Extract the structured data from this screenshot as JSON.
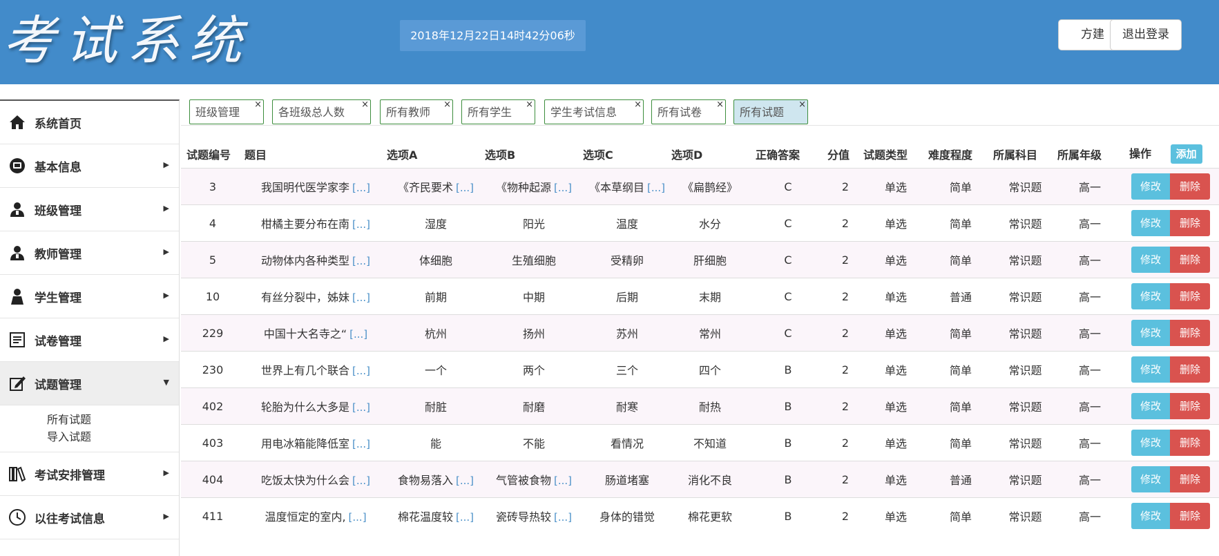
{
  "header": {
    "logo": "考试系统",
    "datetime": "2018年12月22日14时42分06秒",
    "user_label": "方建",
    "logout_label": "退出登录"
  },
  "sidebar": {
    "items": [
      {
        "label": "系统首页",
        "icon": "home-icon",
        "arrow": ""
      },
      {
        "label": "基本信息",
        "icon": "info-icon",
        "arrow": "▶"
      },
      {
        "label": "班级管理",
        "icon": "user-icon",
        "arrow": "▶"
      },
      {
        "label": "教师管理",
        "icon": "user-icon",
        "arrow": "▶"
      },
      {
        "label": "学生管理",
        "icon": "student-icon",
        "arrow": "▶"
      },
      {
        "label": "试卷管理",
        "icon": "document-icon",
        "arrow": "▶"
      },
      {
        "label": "试题管理",
        "icon": "edit-icon",
        "arrow": "▼"
      },
      {
        "label": "考试安排管理",
        "icon": "books-icon",
        "arrow": "▶"
      },
      {
        "label": "以往考试信息",
        "icon": "clock-icon",
        "arrow": "▶"
      }
    ],
    "submenu": [
      "所有试题",
      "导入试题"
    ]
  },
  "tabs": [
    {
      "label": "班级管理",
      "close": "×"
    },
    {
      "label": "各班级总人数",
      "close": "×"
    },
    {
      "label": "所有教师",
      "close": "×"
    },
    {
      "label": "所有学生",
      "close": "×"
    },
    {
      "label": "学生考试信息",
      "close": "×"
    },
    {
      "label": "所有试卷",
      "close": "×"
    },
    {
      "label": "所有试题",
      "close": "×"
    }
  ],
  "table": {
    "columns": [
      "试题编号",
      "题目",
      "选项A",
      "选项B",
      "选项C",
      "选项D",
      "正确答案",
      "分值",
      "试题类型",
      "难度程度",
      "所属科目",
      "所属年级",
      "操作"
    ],
    "add_label": "添加",
    "edit_label": "修改",
    "delete_label": "删除",
    "more": "[...]",
    "rows": [
      {
        "id": "3",
        "title": "我国明代医学家李",
        "a": "《齐民要术",
        "a_more": true,
        "b": "《物种起源",
        "b_more": true,
        "c": "《本草纲目",
        "c_more": true,
        "d": "《扁鹊经》",
        "answer": "C",
        "score": "2",
        "type": "单选",
        "difficulty": "简单",
        "subject": "常识题",
        "grade": "高一"
      },
      {
        "id": "4",
        "title": "柑橘主要分布在南",
        "a": "湿度",
        "a_more": false,
        "b": "阳光",
        "b_more": false,
        "c": "温度",
        "c_more": false,
        "d": "水分",
        "answer": "C",
        "score": "2",
        "type": "单选",
        "difficulty": "简单",
        "subject": "常识题",
        "grade": "高一"
      },
      {
        "id": "5",
        "title": "动物体内各种类型",
        "a": "体细胞",
        "a_more": false,
        "b": "生殖细胞",
        "b_more": false,
        "c": "受精卵",
        "c_more": false,
        "d": "肝细胞",
        "answer": "C",
        "score": "2",
        "type": "单选",
        "difficulty": "简单",
        "subject": "常识题",
        "grade": "高一"
      },
      {
        "id": "10",
        "title": "有丝分裂中，姊妹",
        "a": "前期",
        "a_more": false,
        "b": "中期",
        "b_more": false,
        "c": "后期",
        "c_more": false,
        "d": "末期",
        "answer": "C",
        "score": "2",
        "type": "单选",
        "difficulty": "普通",
        "subject": "常识题",
        "grade": "高一"
      },
      {
        "id": "229",
        "title": "中国十大名寺之“",
        "a": "杭州",
        "a_more": false,
        "b": "扬州",
        "b_more": false,
        "c": "苏州",
        "c_more": false,
        "d": "常州",
        "answer": "C",
        "score": "2",
        "type": "单选",
        "difficulty": "简单",
        "subject": "常识题",
        "grade": "高一"
      },
      {
        "id": "230",
        "title": "世界上有几个联合",
        "a": "一个",
        "a_more": false,
        "b": "两个",
        "b_more": false,
        "c": "三个",
        "c_more": false,
        "d": "四个",
        "answer": "B",
        "score": "2",
        "type": "单选",
        "difficulty": "简单",
        "subject": "常识题",
        "grade": "高一"
      },
      {
        "id": "402",
        "title": "轮胎为什么大多是",
        "a": "耐脏",
        "a_more": false,
        "b": "耐磨",
        "b_more": false,
        "c": "耐寒",
        "c_more": false,
        "d": "耐热",
        "answer": "B",
        "score": "2",
        "type": "单选",
        "difficulty": "简单",
        "subject": "常识题",
        "grade": "高一"
      },
      {
        "id": "403",
        "title": "用电冰箱能降低室",
        "a": "能",
        "a_more": false,
        "b": "不能",
        "b_more": false,
        "c": "看情况",
        "c_more": false,
        "d": "不知道",
        "answer": "B",
        "score": "2",
        "type": "单选",
        "difficulty": "简单",
        "subject": "常识题",
        "grade": "高一"
      },
      {
        "id": "404",
        "title": "吃饭太快为什么会",
        "a": "食物易落入",
        "a_more": true,
        "b": "气管被食物",
        "b_more": true,
        "c": "肠道堵塞",
        "c_more": false,
        "d": "消化不良",
        "answer": "B",
        "score": "2",
        "type": "单选",
        "difficulty": "普通",
        "subject": "常识题",
        "grade": "高一"
      },
      {
        "id": "411",
        "title": "温度恒定的室内,",
        "a": "棉花温度较",
        "a_more": true,
        "b": "瓷砖导热较",
        "b_more": true,
        "c": "身体的错觉",
        "c_more": false,
        "d": "棉花更软",
        "answer": "B",
        "score": "2",
        "type": "单选",
        "difficulty": "简单",
        "subject": "常识题",
        "grade": "高一"
      }
    ]
  },
  "colors": {
    "header": "#428bca",
    "edit": "#5bc0de",
    "delete": "#d9534f",
    "tab_border": "#3c8d3c"
  }
}
